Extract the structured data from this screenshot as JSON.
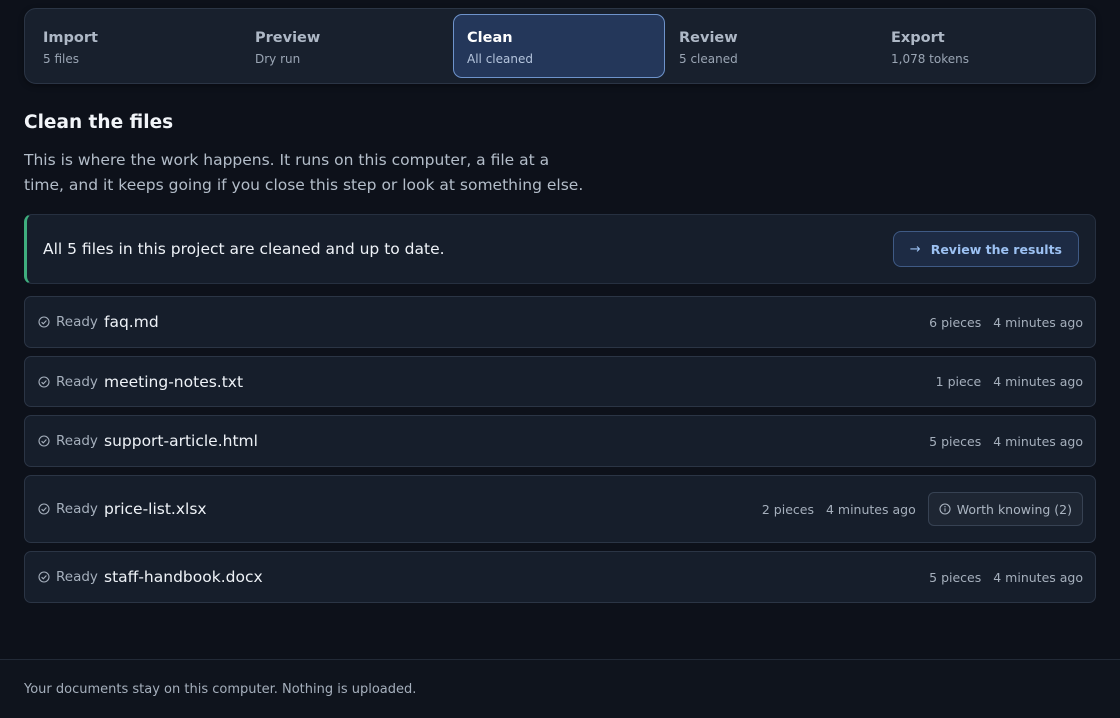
{
  "steps": [
    {
      "name": "Import",
      "sub": "5 files"
    },
    {
      "name": "Preview",
      "sub": "Dry run"
    },
    {
      "name": "Clean",
      "sub": "All cleaned"
    },
    {
      "name": "Review",
      "sub": "5 cleaned"
    },
    {
      "name": "Export",
      "sub": "1,078 tokens"
    }
  ],
  "active_step": "Clean",
  "page": {
    "title": "Clean the files",
    "intro": "This is where the work happens. It runs on this computer, a file at a time, and it keeps going if you close this step or look at something else."
  },
  "banner": {
    "message": "All 5 files in this project are cleaned and up to date.",
    "button_label": "Review the results",
    "button_icon": "arrow-right-icon"
  },
  "files": [
    {
      "status": "Ready",
      "name": "faq.md",
      "pieces": "6 pieces",
      "time": "4 minutes ago"
    },
    {
      "status": "Ready",
      "name": "meeting-notes.txt",
      "pieces": "1 piece",
      "time": "4 minutes ago"
    },
    {
      "status": "Ready",
      "name": "support-article.html",
      "pieces": "5 pieces",
      "time": "4 minutes ago"
    },
    {
      "status": "Ready",
      "name": "price-list.xlsx",
      "pieces": "2 pieces",
      "time": "4 minutes ago",
      "note": "Worth knowing (2)"
    },
    {
      "status": "Ready",
      "name": "staff-handbook.docx",
      "pieces": "5 pieces",
      "time": "4 minutes ago"
    }
  ],
  "footer": {
    "text": "Your documents stay on this computer. Nothing is uploaded."
  },
  "colors": {
    "background": "#0d111a",
    "accent": "#6e93cb",
    "success": "#3fae7e",
    "link": "#9cc1f2"
  }
}
